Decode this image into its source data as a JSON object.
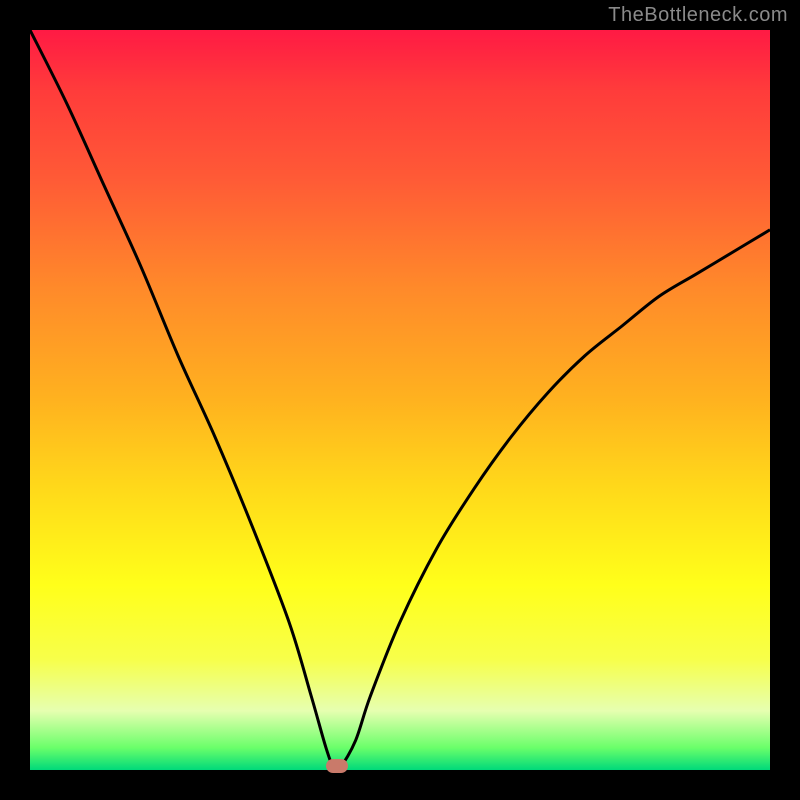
{
  "watermark": "TheBottleneck.com",
  "colors": {
    "frame": "#000000",
    "curve": "#000000",
    "marker": "#c97a6a"
  },
  "chart_data": {
    "type": "line",
    "title": "",
    "xlabel": "",
    "ylabel": "",
    "xlim": [
      0,
      100
    ],
    "ylim": [
      0,
      100
    ],
    "x": [
      0,
      5,
      10,
      15,
      20,
      25,
      30,
      35,
      38,
      40,
      41,
      42,
      44,
      46,
      50,
      55,
      60,
      65,
      70,
      75,
      80,
      85,
      90,
      95,
      100
    ],
    "values": [
      100,
      90,
      79,
      68,
      56,
      45,
      33,
      20,
      10,
      3,
      0.5,
      0.5,
      4,
      10,
      20,
      30,
      38,
      45,
      51,
      56,
      60,
      64,
      67,
      70,
      73
    ],
    "marker": {
      "x": 41.5,
      "y": 0.5
    },
    "grid": false,
    "legend": false
  }
}
